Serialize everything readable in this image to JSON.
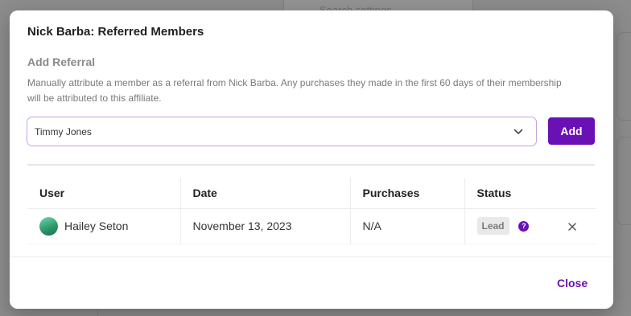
{
  "background": {
    "search_placeholder": "Search settings"
  },
  "modal": {
    "title": "Nick Barba: Referred Members",
    "add_referral": {
      "heading": "Add Referral",
      "description": "Manually attribute a member as a referral from Nick Barba. Any purchases they made in the first 60 days of their membership will be attributed to this affiliate.",
      "selected_member": "Timmy Jones",
      "add_label": "Add"
    },
    "table": {
      "headers": [
        "User",
        "Date",
        "Purchases",
        "Status"
      ],
      "rows": [
        {
          "user": "Hailey Seton",
          "date": "November 13, 2023",
          "purchases": "N/A",
          "status": "Lead"
        }
      ]
    },
    "close_label": "Close"
  },
  "icons": {
    "chevron": "chevron-down-icon",
    "help": "question-icon",
    "remove": "close-icon"
  },
  "colors": {
    "accent": "#6a11b6",
    "select_border": "#c8a3e0",
    "badge_bg": "#e9e9e9"
  }
}
